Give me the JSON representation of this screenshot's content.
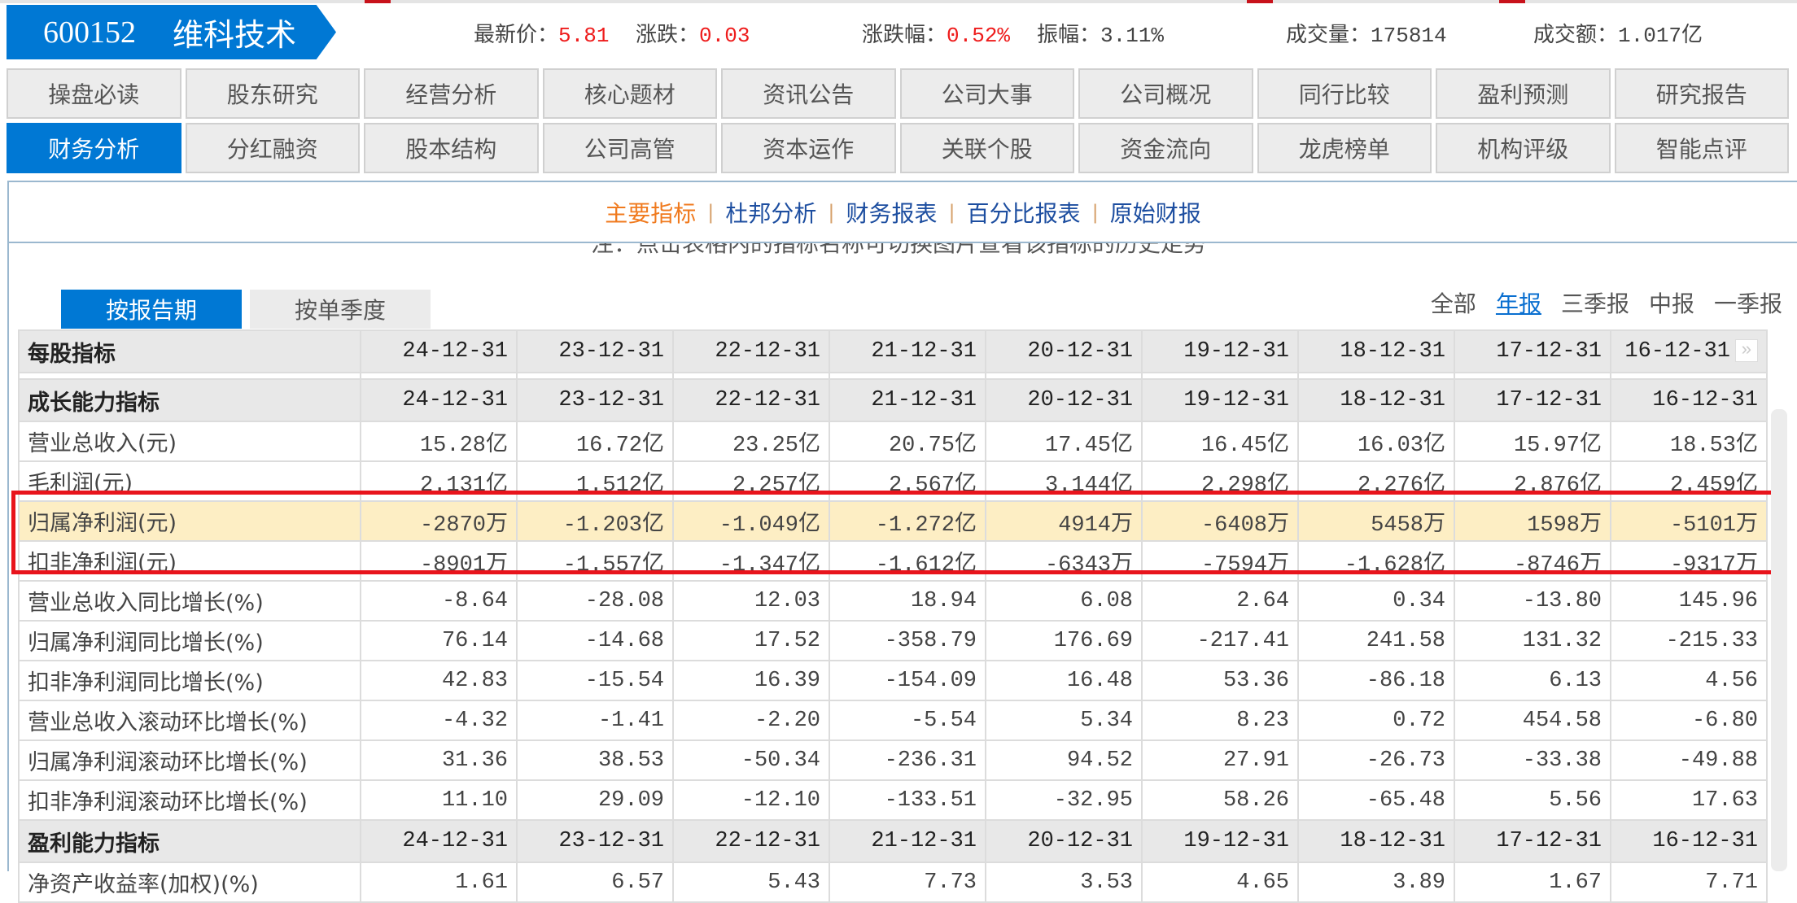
{
  "header": {
    "code": "600152",
    "name": "维科技术",
    "stats": [
      {
        "label": "最新价：",
        "value": "5.81",
        "red": true
      },
      {
        "label": "涨跌：",
        "value": "0.03",
        "red": true
      },
      {
        "label": "涨跌幅：",
        "value": "0.52%",
        "red": true
      },
      {
        "label": "振幅：",
        "value": "3.11%",
        "red": false
      },
      {
        "label": "成交量：",
        "value": "175814",
        "red": false
      },
      {
        "label": "成交额：",
        "value": "1.017亿",
        "red": false
      }
    ]
  },
  "nav": {
    "row1": [
      "操盘必读",
      "股东研究",
      "经营分析",
      "核心题材",
      "资讯公告",
      "公司大事",
      "公司概况",
      "同行比较",
      "盈利预测",
      "研究报告"
    ],
    "row2": [
      "财务分析",
      "分红融资",
      "股本结构",
      "公司高管",
      "资本运作",
      "关联个股",
      "资金流向",
      "龙虎榜单",
      "机构评级",
      "智能点评"
    ],
    "active": "财务分析"
  },
  "subtabs": {
    "items": [
      "主要指标",
      "杜邦分析",
      "财务报表",
      "百分比报表",
      "原始财报"
    ],
    "active": "主要指标"
  },
  "note": "注：点击表格内的指标名称可切换图片查看该指标的历史走势",
  "report_tabs": {
    "items": [
      "按报告期",
      "按单季度"
    ],
    "active": "按报告期"
  },
  "period_links": {
    "items": [
      "全部",
      "年报",
      "三季报",
      "中报",
      "一季报"
    ],
    "active": "年报"
  },
  "colors": {
    "accent": "#0078d4",
    "up": "#ee1c1c",
    "highlight": "#fdeec4",
    "box": "#e8141c"
  },
  "table": {
    "periods": [
      "24-12-31",
      "23-12-31",
      "22-12-31",
      "21-12-31",
      "20-12-31",
      "19-12-31",
      "18-12-31",
      "17-12-31",
      "16-12-31"
    ],
    "sections": [
      {
        "title": "每股指标",
        "rows": []
      },
      {
        "title": "成长能力指标",
        "rows": [
          {
            "label": "营业总收入(元)",
            "values": [
              "15.28亿",
              "16.72亿",
              "23.25亿",
              "20.75亿",
              "17.45亿",
              "16.45亿",
              "16.03亿",
              "15.97亿",
              "18.53亿"
            ]
          },
          {
            "label": "毛利润(元)",
            "values": [
              "2.131亿",
              "1.512亿",
              "2.257亿",
              "2.567亿",
              "3.144亿",
              "2.298亿",
              "2.276亿",
              "2.876亿",
              "2.459亿"
            ]
          },
          {
            "label": "归属净利润(元)",
            "highlight": true,
            "values": [
              "-2870万",
              "-1.203亿",
              "-1.049亿",
              "-1.272亿",
              "4914万",
              "-6408万",
              "5458万",
              "1598万",
              "-5101万"
            ]
          },
          {
            "label": "扣非净利润(元)",
            "values": [
              "-8901万",
              "-1.557亿",
              "-1.347亿",
              "-1.612亿",
              "-6343万",
              "-7594万",
              "-1.628亿",
              "-8746万",
              "-9317万"
            ]
          },
          {
            "label": "营业总收入同比增长(%)",
            "values": [
              "-8.64",
              "-28.08",
              "12.03",
              "18.94",
              "6.08",
              "2.64",
              "0.34",
              "-13.80",
              "145.96"
            ]
          },
          {
            "label": "归属净利润同比增长(%)",
            "values": [
              "76.14",
              "-14.68",
              "17.52",
              "-358.79",
              "176.69",
              "-217.41",
              "241.58",
              "131.32",
              "-215.33"
            ]
          },
          {
            "label": "扣非净利润同比增长(%)",
            "values": [
              "42.83",
              "-15.54",
              "16.39",
              "-154.09",
              "16.48",
              "53.36",
              "-86.18",
              "6.13",
              "4.56"
            ]
          },
          {
            "label": "营业总收入滚动环比增长(%)",
            "values": [
              "-4.32",
              "-1.41",
              "-2.20",
              "-5.54",
              "5.34",
              "8.23",
              "0.72",
              "454.58",
              "-6.80"
            ]
          },
          {
            "label": "归属净利润滚动环比增长(%)",
            "values": [
              "31.36",
              "38.53",
              "-50.34",
              "-236.31",
              "94.52",
              "27.91",
              "-26.73",
              "-33.38",
              "-49.88"
            ]
          },
          {
            "label": "扣非净利润滚动环比增长(%)",
            "values": [
              "11.10",
              "29.09",
              "-12.10",
              "-133.51",
              "-32.95",
              "58.26",
              "-65.48",
              "5.56",
              "17.63"
            ]
          }
        ]
      },
      {
        "title": "盈利能力指标",
        "rows": [
          {
            "label": "净资产收益率(加权)(%)",
            "values": [
              "1.61",
              "6.57",
              "5.43",
              "7.73",
              "3.53",
              "4.65",
              "3.89",
              "1.67",
              "7.71"
            ]
          }
        ]
      }
    ]
  }
}
